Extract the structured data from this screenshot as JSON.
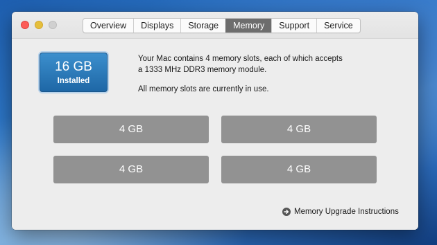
{
  "window": {
    "tabs": [
      {
        "label": "Overview",
        "active": false
      },
      {
        "label": "Displays",
        "active": false
      },
      {
        "label": "Storage",
        "active": false
      },
      {
        "label": "Memory",
        "active": true
      },
      {
        "label": "Support",
        "active": false
      },
      {
        "label": "Service",
        "active": false
      }
    ]
  },
  "memory": {
    "installed_size": "16 GB",
    "installed_label": "Installed",
    "description_line1": "Your Mac contains 4 memory slots, each of which accepts",
    "description_line2": "a 1333 MHz DDR3 memory module.",
    "status": "All memory slots are currently in use.",
    "slots": [
      "4 GB",
      "4 GB",
      "4 GB",
      "4 GB"
    ],
    "upgrade_link": "Memory Upgrade Instructions"
  },
  "colors": {
    "accent": "#2a7bc0",
    "slot_fill": "#929292",
    "active_tab": "#6d6d6d"
  },
  "icons": {
    "upgrade_link": "arrow-circle-right-icon"
  }
}
